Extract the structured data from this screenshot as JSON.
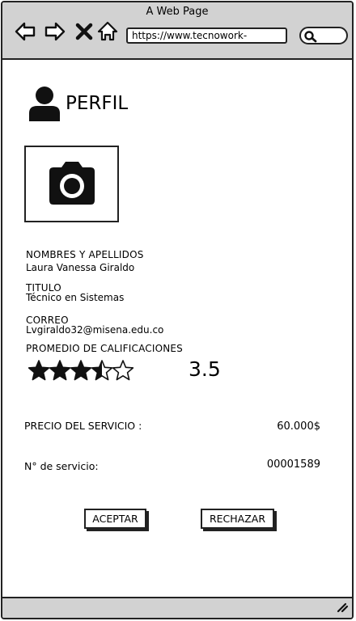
{
  "window": {
    "title": "A Web Page"
  },
  "browser": {
    "url": "https://www.tecnowork-"
  },
  "page": {
    "title": "PERFIL"
  },
  "profile": {
    "names_label": "NOMBRES Y APELLIDOS",
    "names_value": "Laura Vanessa Giraldo",
    "title_label": "TITULO",
    "title_value": "Técnico en Sistemas",
    "email_label": "CORREO",
    "email_value": "Lvgiraldo32@misena.edu.co",
    "rating_label": "PROMEDIO DE CALIFICACIONES",
    "rating_value": "3.5",
    "rating_numeric": 3.5,
    "rating_max": 5
  },
  "service": {
    "price_label": "PRECIO DEL SERVICIO :",
    "price_value": "60.000$",
    "number_label": "N° de servicio:",
    "number_value": "00001589"
  },
  "actions": {
    "accept_label": "ACEPTAR",
    "reject_label": "RECHAZAR"
  },
  "icons": {
    "back": "arrow-left-icon",
    "forward": "arrow-right-icon",
    "stop": "close-icon",
    "home": "home-icon",
    "search": "search-icon",
    "profile": "user-icon",
    "photo": "camera-icon",
    "star": "star-icon",
    "resize": "resize-grip-icon"
  }
}
